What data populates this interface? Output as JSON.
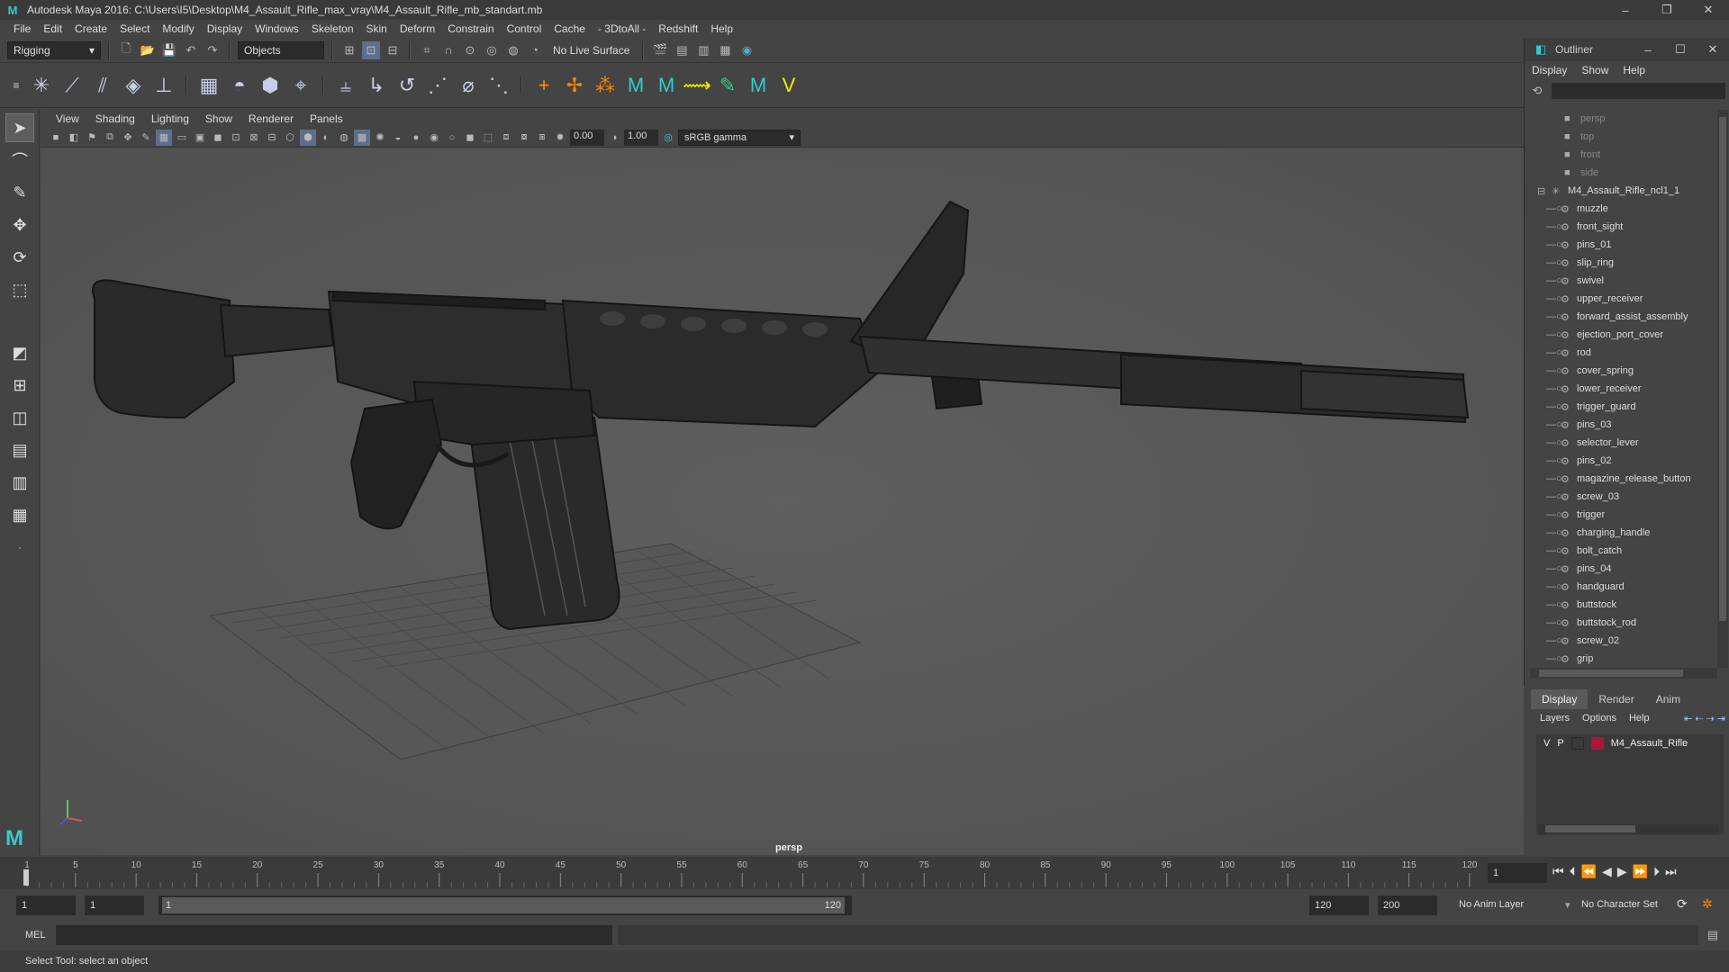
{
  "window": {
    "title": "Autodesk Maya 2016: C:\\Users\\I5\\Desktop\\M4_Assault_Rifle_max_vray\\M4_Assault_Rifle_mb_standart.mb",
    "minimize": "–",
    "maximize": "❐",
    "close": "✕"
  },
  "menubar": [
    "File",
    "Edit",
    "Create",
    "Select",
    "Modify",
    "Display",
    "Windows",
    "Skeleton",
    "Skin",
    "Deform",
    "Constrain",
    "Control",
    "Cache",
    "- 3DtoAll -",
    "Redshift",
    "Help"
  ],
  "statusline": {
    "menuset": "Rigging",
    "selection_mode": "Objects",
    "live_surface": "No Live Surface"
  },
  "panel": {
    "menus": [
      "View",
      "Shading",
      "Lighting",
      "Show",
      "Renderer",
      "Panels"
    ],
    "exposure": "0.00",
    "gamma": "1.00",
    "color_space": "sRGB gamma",
    "camera_label": "persp"
  },
  "outliner": {
    "title": "Outliner",
    "menus": [
      "Display",
      "Show",
      "Help"
    ],
    "cameras": [
      "persp",
      "top",
      "front",
      "side"
    ],
    "root": "M4_Assault_Rifle_ncl1_1",
    "children": [
      "muzzle",
      "front_sight",
      "pins_01",
      "slip_ring",
      "swivel",
      "upper_receiver",
      "forward_assist_assembly",
      "ejection_port_cover",
      "rod",
      "cover_spring",
      "lower_receiver",
      "trigger_guard",
      "pins_03",
      "selector_lever",
      "pins_02",
      "magazine_release_button",
      "screw_03",
      "trigger",
      "charging_handle",
      "bolt_catch",
      "pins_04",
      "handguard",
      "buttstock",
      "buttstock_rod",
      "screw_02",
      "grip"
    ]
  },
  "layers": {
    "tabs": [
      "Display",
      "Render",
      "Anim"
    ],
    "menus": [
      "Layers",
      "Options",
      "Help"
    ],
    "layer_name": "M4_Assault_Rifle",
    "layer_color": "#b0143a",
    "v": "V",
    "p": "P"
  },
  "timeline": {
    "ticks": [
      "5",
      "10",
      "15",
      "20",
      "25",
      "30",
      "35",
      "40",
      "45",
      "50",
      "55",
      "60",
      "65",
      "70",
      "75",
      "80",
      "85",
      "90",
      "95",
      "100",
      "105",
      "110",
      "115",
      "120"
    ],
    "first": "1",
    "current_frame": "1"
  },
  "range": {
    "start": "1",
    "playback_start": "1",
    "slider_start": "1",
    "slider_end": "120",
    "playback_end": "120",
    "end": "200",
    "anim_layer": "No Anim Layer",
    "character_set": "No Character Set"
  },
  "cmdline": {
    "label": "MEL"
  },
  "helpline": {
    "text": "Select Tool: select an object"
  }
}
